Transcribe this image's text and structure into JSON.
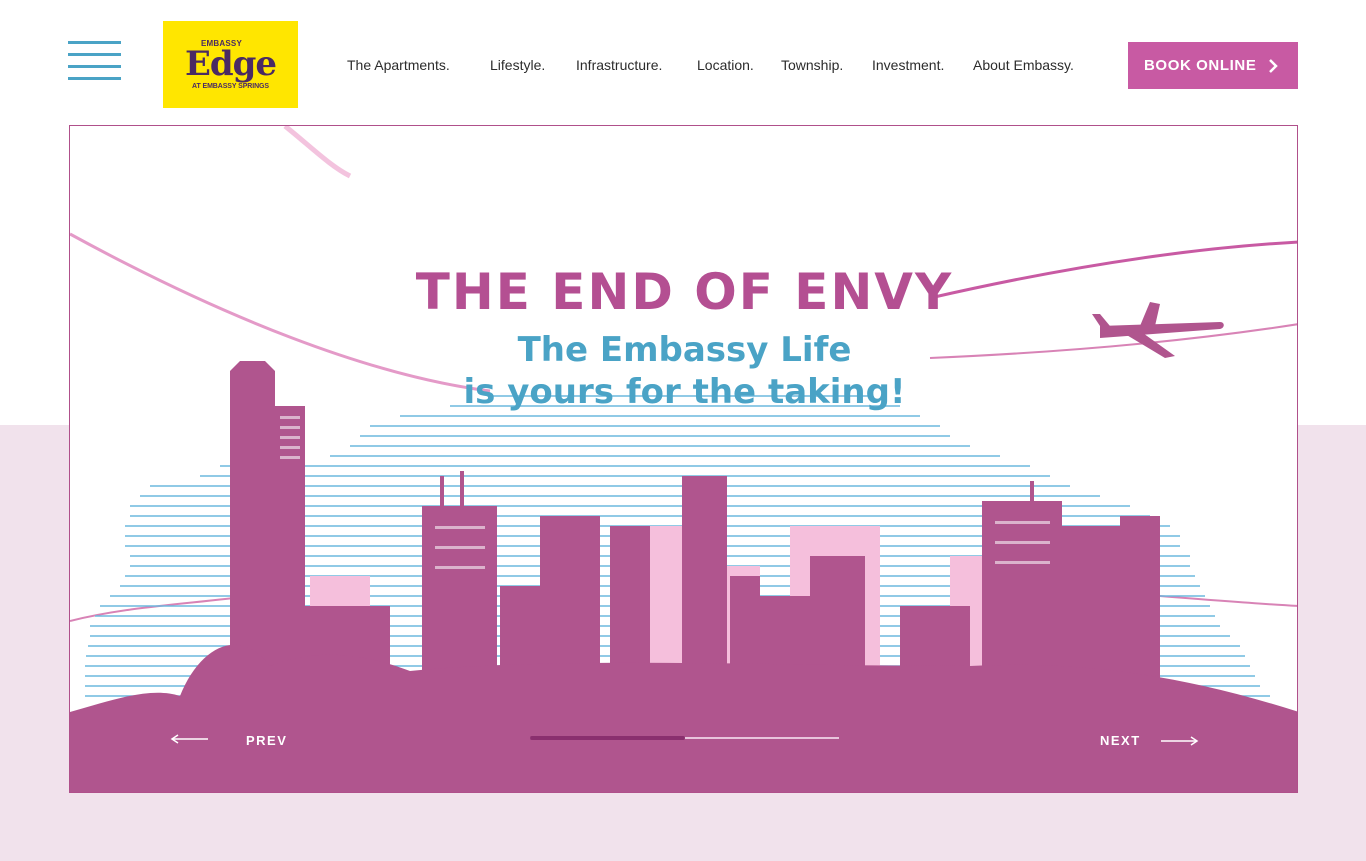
{
  "header": {
    "logo": {
      "top": "EMBASSY",
      "main": "Edge",
      "bottom": "AT EMBASSY SPRINGS"
    },
    "menu_icon": "hamburger-icon",
    "nav": [
      {
        "label": "The Apartments."
      },
      {
        "label": "Lifestyle."
      },
      {
        "label": "Infrastructure."
      },
      {
        "label": "Location."
      },
      {
        "label": "Township."
      },
      {
        "label": "Investment."
      },
      {
        "label": "About Embassy."
      }
    ],
    "book_button": {
      "label": "BOOK ONLINE",
      "icon": "chevron-right-icon"
    }
  },
  "hero": {
    "headline": "THE END OF ENVY",
    "subline_1": "The Embassy Life",
    "subline_2": "is yours for the taking!",
    "prev_label": "PREV",
    "next_label": "NEXT",
    "slide_progress": 0.5
  },
  "colors": {
    "accent_magenta": "#b0558e",
    "headline_pink": "#b44f92",
    "sub_blue": "#4aa3c6",
    "logo_yellow": "#ffe600",
    "button_pink": "#c85aa3",
    "band_pink": "#f1e2ec"
  }
}
